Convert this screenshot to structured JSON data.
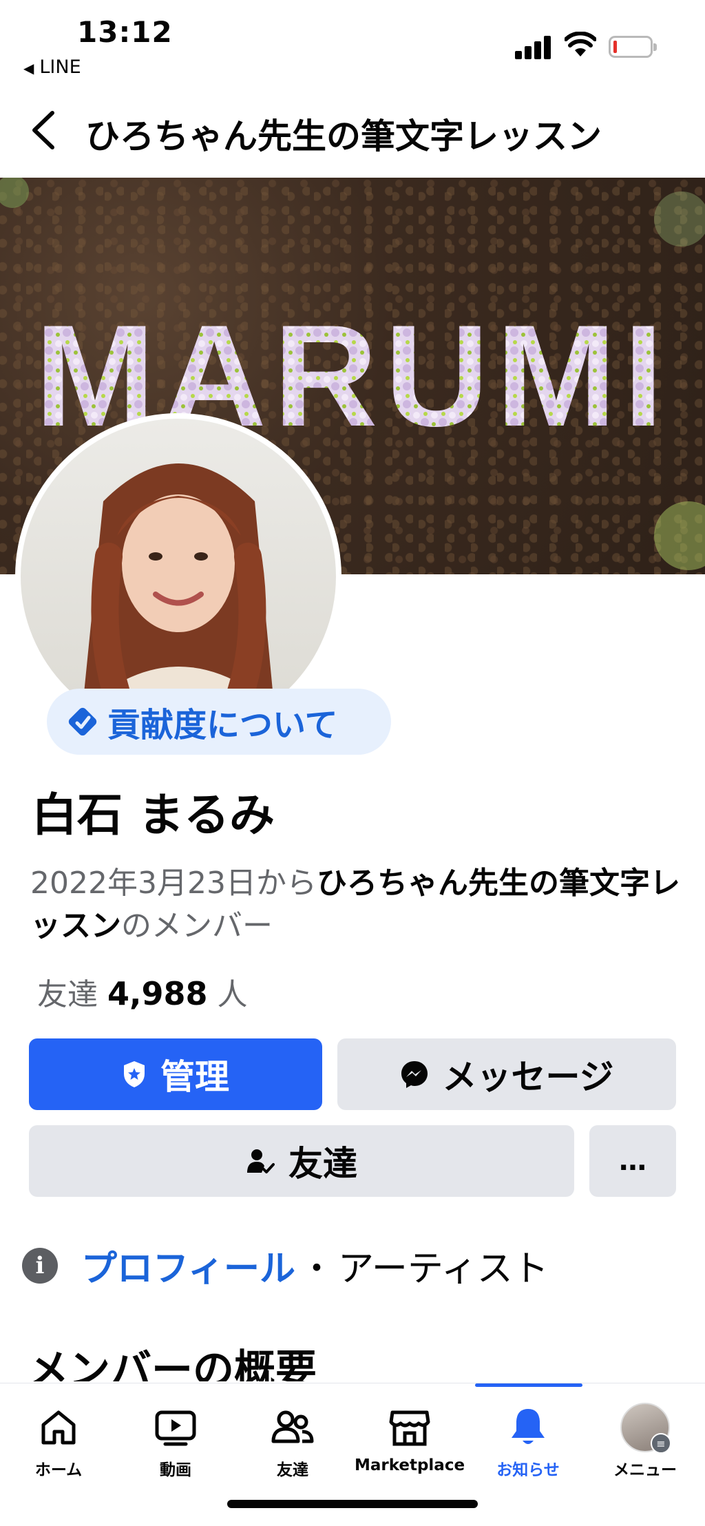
{
  "status_bar": {
    "time": "13:12",
    "back_app": "LINE"
  },
  "header": {
    "title": "ひろちゃん先生の筆文字レッスン"
  },
  "cover": {
    "text": "MARUMI"
  },
  "contrib_chip": {
    "label": "貢献度について"
  },
  "profile": {
    "name": "白石 まるみ",
    "member_prefix": "2022年3月23日から",
    "group_name": "ひろちゃん先生の筆文字レッスン",
    "member_suffix": "のメンバー",
    "friends_prefix": "友達",
    "friends_count": "4,988",
    "friends_suffix": "人"
  },
  "actions": {
    "manage": "管理",
    "message": "メッセージ",
    "friends": "友達",
    "more": "…"
  },
  "profile_row": {
    "info_icon": "i",
    "link": "プロフィール",
    "separator": "・",
    "category": "アーティスト"
  },
  "section": {
    "title": "メンバーの概要"
  },
  "bottom_nav": {
    "items": [
      {
        "label": "ホーム",
        "icon": "home-icon"
      },
      {
        "label": "動画",
        "icon": "video-icon"
      },
      {
        "label": "友達",
        "icon": "friends-icon"
      },
      {
        "label": "Marketplace",
        "icon": "marketplace-icon"
      },
      {
        "label": "お知らせ",
        "icon": "bell-icon"
      },
      {
        "label": "メニュー",
        "icon": "menu-avatar"
      }
    ],
    "active_index": 4
  },
  "colors": {
    "accent": "#2563f5",
    "link": "#1b64d9",
    "chip_bg": "#e7f0fd",
    "button_bg": "#e4e6eb",
    "muted": "#65676b"
  }
}
